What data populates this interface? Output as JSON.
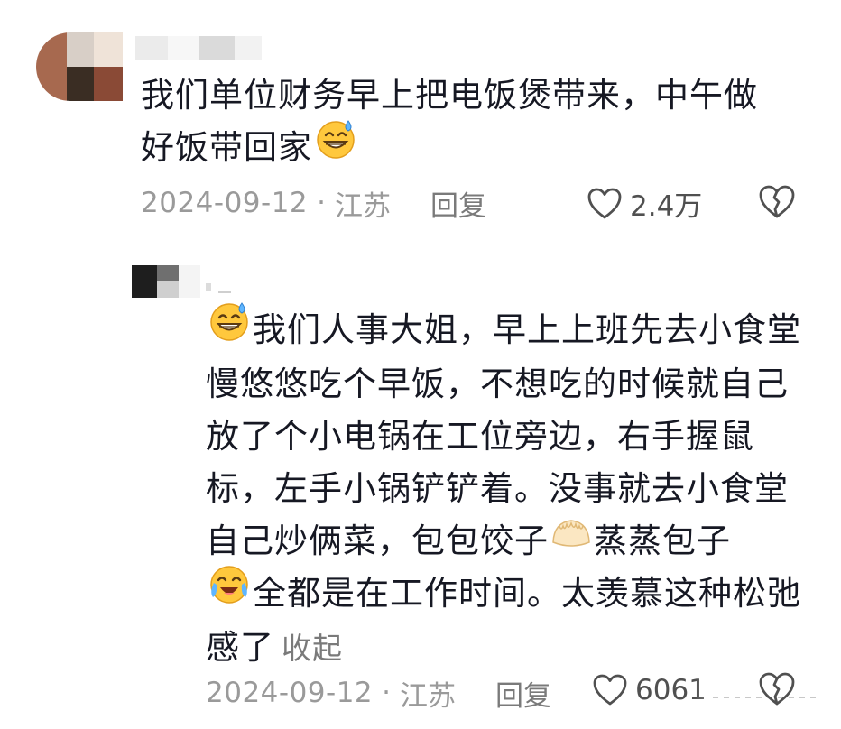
{
  "comments": [
    {
      "text_line1": "我们单位财务早上把电饭煲带来，中午做",
      "text_line2": "好饭带回家",
      "date": "2024-09-12",
      "location": "江苏",
      "reply_label": "回复",
      "likes": "2.4万",
      "emoji": "grin-sweat-emoji"
    },
    {
      "segments": [
        "我们人事大姐，早上上班先去小食堂慢悠悠吃个早饭，不想吃的时候就自己放了个小电锅在工位旁边，右手握鼠标，左手小锅铲铲着。没事就去小食堂自己炒俩菜，包包饺子",
        "蒸蒸包子",
        "全都是在工作时间。太羡慕这种松弛感了"
      ],
      "collapse_label": "收起",
      "date": "2024-09-12",
      "location": "江苏",
      "reply_label": "回复",
      "likes": "6061",
      "emojis": [
        "grin-sweat-emoji",
        "dumpling-emoji",
        "laugh-cry-emoji"
      ]
    }
  ],
  "meta_separator": "·",
  "colors": {
    "text": "#161823",
    "meta": "#9a9a9a",
    "reply": "#7a7a7a",
    "emoji_yellow": "#FFC83D"
  }
}
